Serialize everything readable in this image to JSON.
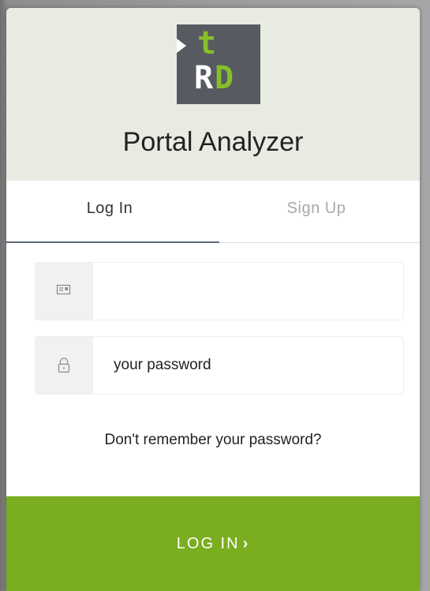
{
  "header": {
    "logo": {
      "letter_top": "t",
      "letter_left": "R",
      "letter_right": "D",
      "bg_color": "#575b61",
      "accent_color": "#86bf2a"
    },
    "app_title": "Portal Analyzer"
  },
  "tabs": [
    {
      "label": "Log In",
      "active": true
    },
    {
      "label": "Sign Up",
      "active": false
    }
  ],
  "form": {
    "email": {
      "value": "",
      "placeholder": "",
      "icon": "id-card-icon"
    },
    "password": {
      "value": "",
      "placeholder": "your password",
      "icon": "lock-icon"
    },
    "forgot_link": "Don't remember your password?",
    "submit_label": "LOG IN",
    "submit_chevron": "›"
  },
  "colors": {
    "header_bg": "#e8ebe2",
    "submit_bg": "#7aad1f",
    "tab_underline": "#5f6b7a"
  }
}
